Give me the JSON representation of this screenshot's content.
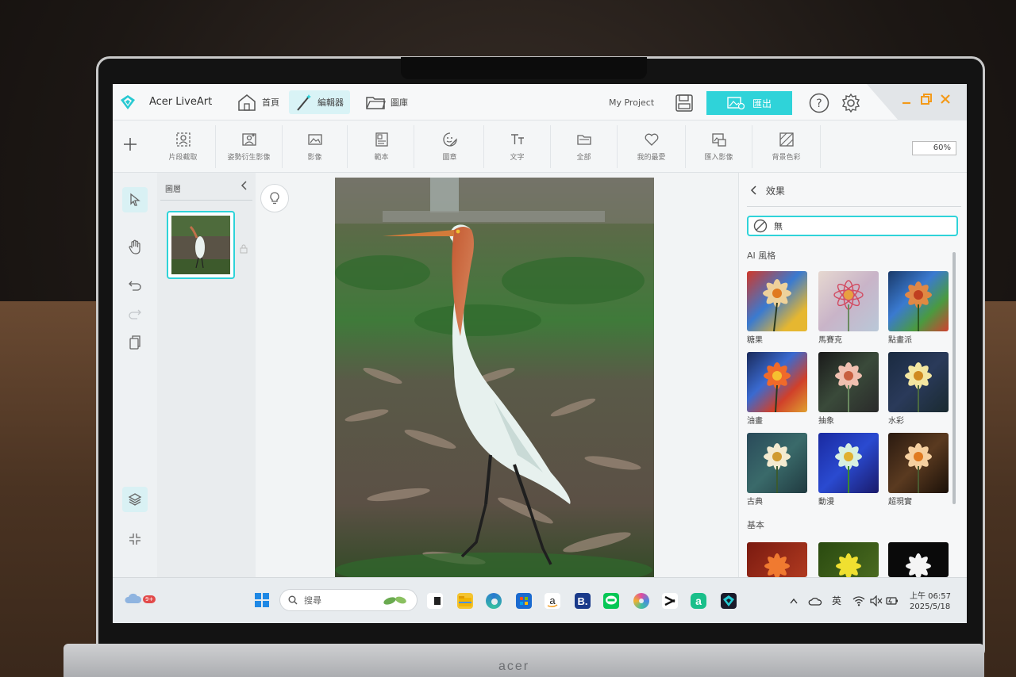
{
  "app": {
    "title": "Acer LiveArt",
    "nav": [
      {
        "label": "首頁",
        "icon": "home-icon"
      },
      {
        "label": "編輯器",
        "icon": "wand-icon"
      },
      {
        "label": "圖庫",
        "icon": "folder-icon"
      }
    ],
    "project_name": "My Project",
    "export_label": "匯出"
  },
  "ribbon": {
    "tools": [
      {
        "label": "片段截取",
        "icon": "portrait-crop-icon"
      },
      {
        "label": "姿勢衍生影像",
        "icon": "pose-image-icon"
      },
      {
        "label": "影像",
        "icon": "image-icon"
      },
      {
        "label": "範本",
        "icon": "template-icon"
      },
      {
        "label": "圖章",
        "icon": "sticker-icon"
      },
      {
        "label": "文字",
        "icon": "text-icon"
      },
      {
        "label": "全部",
        "icon": "folder-open-icon"
      },
      {
        "label": "我的最愛",
        "icon": "heart-icon"
      },
      {
        "label": "匯入影像",
        "icon": "import-image-icon"
      },
      {
        "label": "背景色彩",
        "icon": "background-color-icon"
      }
    ],
    "zoom": "60%"
  },
  "layers": {
    "title": "圖層"
  },
  "effects": {
    "header": "效果",
    "none_label": "無",
    "ai_section": "AI 風格",
    "ai_styles": [
      "糖果",
      "馬賽克",
      "點畫派",
      "油畫",
      "抽象",
      "水彩",
      "古典",
      "動漫",
      "超現實"
    ],
    "basic_section": "基本"
  },
  "taskbar": {
    "weather_badge": "9+",
    "search_placeholder": "搜尋",
    "ime": "英",
    "time": "上午 06:57",
    "date": "2025/5/18"
  },
  "hardware": {
    "brand": "acer"
  }
}
